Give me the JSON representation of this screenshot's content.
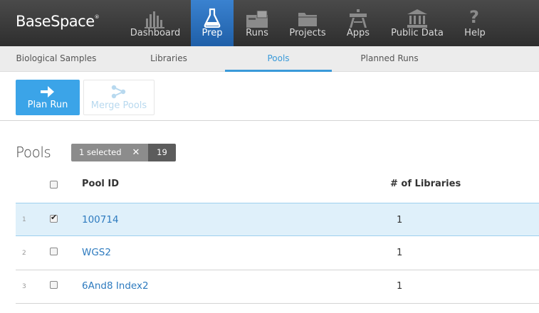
{
  "brand": {
    "name": "BaseSpace",
    "mark": "®"
  },
  "nav": [
    {
      "label": "Dashboard",
      "icon": "bar-chart-icon"
    },
    {
      "label": "Prep",
      "icon": "flask-icon",
      "active": true
    },
    {
      "label": "Runs",
      "icon": "runs-icon"
    },
    {
      "label": "Projects",
      "icon": "folder-icon"
    },
    {
      "label": "Apps",
      "icon": "apps-icon"
    },
    {
      "label": "Public Data",
      "icon": "bank-icon"
    },
    {
      "label": "Help",
      "icon": "question-icon"
    }
  ],
  "subnav": [
    {
      "label": "Biological Samples"
    },
    {
      "label": "Libraries"
    },
    {
      "label": "Pools",
      "active": true
    },
    {
      "label": "Planned Runs"
    }
  ],
  "toolbar": {
    "plan_run": "Plan Run",
    "merge_pools": "Merge Pools"
  },
  "pools": {
    "title": "Pools",
    "selected_label": "1 selected",
    "clear_glyph": "✕",
    "total": "19",
    "columns": {
      "pool_id": "Pool ID",
      "num_libraries": "# of Libraries"
    },
    "rows": [
      {
        "num": "1",
        "pool_id": "100714",
        "libraries": "1",
        "checked": true
      },
      {
        "num": "2",
        "pool_id": "WGS2",
        "libraries": "1",
        "checked": false
      },
      {
        "num": "3",
        "pool_id": "6And8 Index2",
        "libraries": "1",
        "checked": false
      }
    ]
  },
  "colors": {
    "accent": "#3ba4e8",
    "active_nav": "#2a6fbd",
    "link": "#2e7bbf",
    "selected_row": "#dff0fa"
  }
}
